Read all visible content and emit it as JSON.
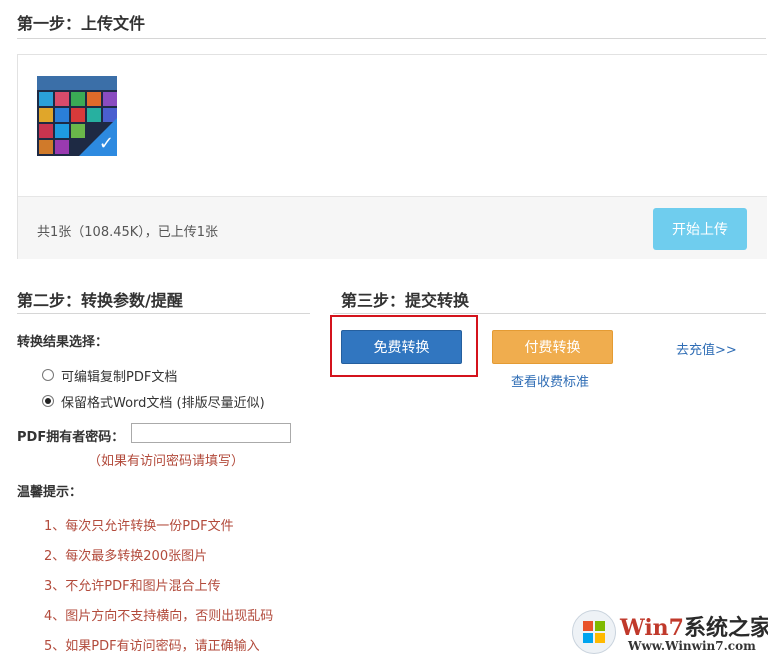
{
  "step1": {
    "title": "第一步：上传文件",
    "status": "共1张（108.45K），已上传1张",
    "start_upload_label": "开始上传"
  },
  "step2": {
    "title": "第二步：转换参数/提醒",
    "result_label": "转换结果选择：",
    "options": [
      {
        "label": "可编辑复制PDF文档",
        "checked": false
      },
      {
        "label": "保留格式Word文档 (排版尽量近似)",
        "checked": true
      }
    ],
    "password_label": "PDF拥有者密码：",
    "password_value": "",
    "password_hint": "（如果有访问密码请填写）",
    "tips_label": "温馨提示：",
    "tips": [
      "1、每次只允许转换一份PDF文件",
      "2、每次最多转换200张图片",
      "3、不允许PDF和图片混合上传",
      "4、图片方向不支持横向，否则出现乱码",
      "5、如果PDF有访问密码，请正确输入"
    ]
  },
  "step3": {
    "title": "第三步：提交转换",
    "free_convert_label": "免费转换",
    "paid_convert_label": "付费转换",
    "recharge_link": "去充值>>",
    "pricing_link": "查看收费标准"
  },
  "watermark": {
    "brand_prefix": "Win7",
    "brand_suffix": "系统之家",
    "url": "Www.Winwin7.com"
  },
  "colors": {
    "free_button": "#3176c0",
    "paid_button": "#f0ad4e",
    "upload_button": "#6fcdee",
    "highlight": "#d4131c",
    "hint_text": "#b24a3b",
    "link": "#2f6db5"
  }
}
